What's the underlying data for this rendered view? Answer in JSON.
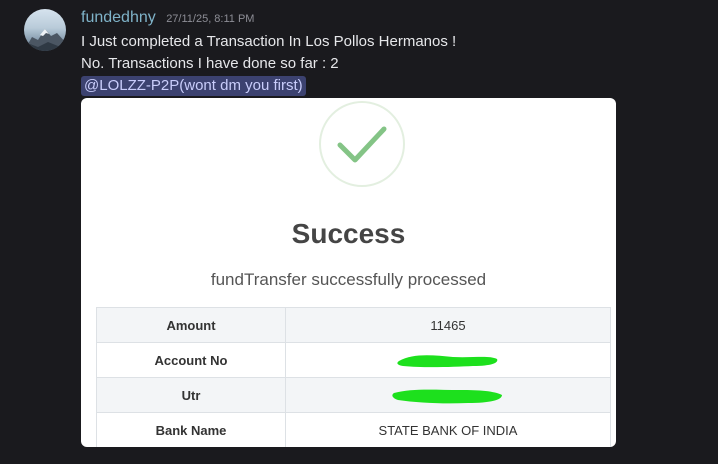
{
  "message": {
    "username": "fundedhny",
    "timestamp": "27/11/25, 8:11 PM",
    "line1": "I Just completed a Transaction In Los Pollos Hermanos !",
    "line2": "No. Transactions I have done so far : 2",
    "mention": "@LOLZZ-P2P(wont dm you first)"
  },
  "card": {
    "title": "Success",
    "subtitle": "fundTransfer successfully processed",
    "rows": [
      {
        "label": "Amount",
        "value": "11465"
      },
      {
        "label": "Account No",
        "value": ""
      },
      {
        "label": "Utr",
        "value": ""
      },
      {
        "label": "Bank Name",
        "value": "STATE BANK OF INDIA"
      }
    ]
  },
  "colors": {
    "background": "#1a1a1e",
    "username": "#7fb3c9",
    "mention_bg": "#3c4270",
    "check": "#84c486",
    "redaction": "#1de01d"
  },
  "icons": {
    "avatar": "mountain-avatar",
    "status": "check-icon"
  }
}
